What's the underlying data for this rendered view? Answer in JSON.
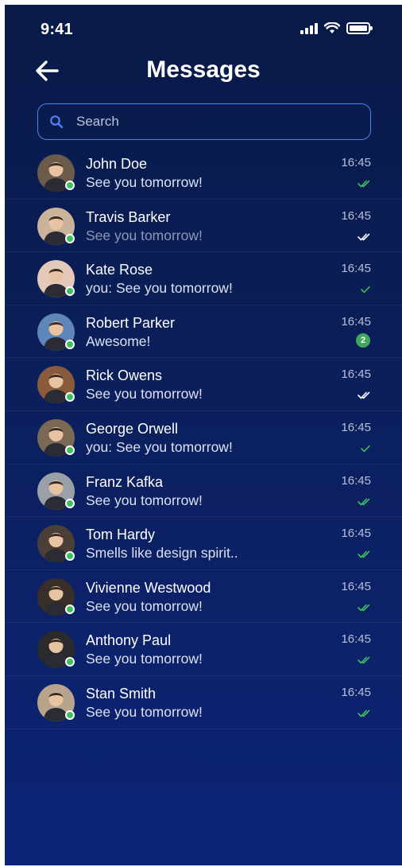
{
  "status_bar": {
    "time": "9:41"
  },
  "header": {
    "title": "Messages"
  },
  "search": {
    "placeholder": "Search"
  },
  "colors": {
    "online": "#3fbf5e",
    "read_check": "#3fbf5e",
    "badge": "#3fa85c",
    "search_border": "#4e83f3"
  },
  "conversations": [
    {
      "name": "John Doe",
      "message": "See you tomorrow!",
      "time": "16:45",
      "status": "read",
      "faded": false,
      "online": true,
      "avatar": "#6c5a4a"
    },
    {
      "name": "Travis Barker",
      "message": "See you tomorrow!",
      "time": "16:45",
      "status": "delivered",
      "faded": true,
      "online": true,
      "avatar": "#c9b39a"
    },
    {
      "name": "Kate Rose",
      "message": "you: See you tomorrow!",
      "time": "16:45",
      "status": "sent",
      "faded": false,
      "online": true,
      "avatar": "#e4c9b8"
    },
    {
      "name": "Robert Parker",
      "message": "Awesome!",
      "time": "16:45",
      "status": "unread",
      "unread_count": "2",
      "faded": false,
      "online": true,
      "avatar": "#5f86b8"
    },
    {
      "name": "Rick Owens",
      "message": "See you tomorrow!",
      "time": "16:45",
      "status": "delivered",
      "faded": false,
      "online": true,
      "avatar": "#8a5a3c"
    },
    {
      "name": "George Orwell",
      "message": "you: See you tomorrow!",
      "time": "16:45",
      "status": "sent",
      "faded": false,
      "online": true,
      "avatar": "#7a6a55"
    },
    {
      "name": "Franz Kafka",
      "message": "See you tomorrow!",
      "time": "16:45",
      "status": "read",
      "faded": false,
      "online": true,
      "avatar": "#9aa0a8"
    },
    {
      "name": "Tom Hardy",
      "message": "Smells like design spirit..",
      "time": "16:45",
      "status": "read",
      "faded": false,
      "online": true,
      "avatar": "#4a4038"
    },
    {
      "name": "Vivienne Westwood",
      "message": "See you tomorrow!",
      "time": "16:45",
      "status": "read",
      "faded": false,
      "online": true,
      "avatar": "#3a2e28"
    },
    {
      "name": "Anthony Paul",
      "message": "See you tomorrow!",
      "time": "16:45",
      "status": "read",
      "faded": false,
      "online": true,
      "avatar": "#2a2a2a"
    },
    {
      "name": "Stan Smith",
      "message": "See you tomorrow!",
      "time": "16:45",
      "status": "read",
      "faded": false,
      "online": true,
      "avatar": "#b8a48c"
    }
  ]
}
